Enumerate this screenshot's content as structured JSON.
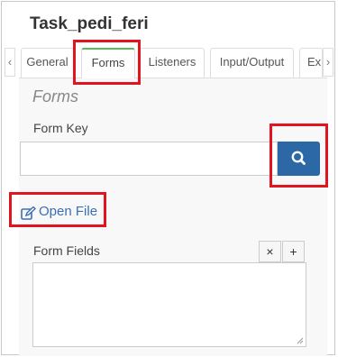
{
  "header": {
    "title": "Task_pedi_feri"
  },
  "tabs": {
    "scroll_left": "‹",
    "items": [
      {
        "label": "General"
      },
      {
        "label": "Forms"
      },
      {
        "label": "Listeners"
      },
      {
        "label": "Input/Output"
      },
      {
        "label": "Ex"
      }
    ],
    "active": "Forms",
    "scroll_right": "›"
  },
  "forms": {
    "section_title": "Forms",
    "form_key_label": "Form Key",
    "form_key_value": "",
    "search_icon": "search-icon",
    "open_file_label": "Open File",
    "open_file_icon": "edit-icon",
    "form_fields_label": "Form Fields",
    "remove_label": "×",
    "add_label": "+"
  },
  "colors": {
    "highlight": "#e0151f",
    "primary_button": "#2c67a6",
    "link": "#3b6fb5",
    "active_tab_indicator": "#5cb85c"
  }
}
